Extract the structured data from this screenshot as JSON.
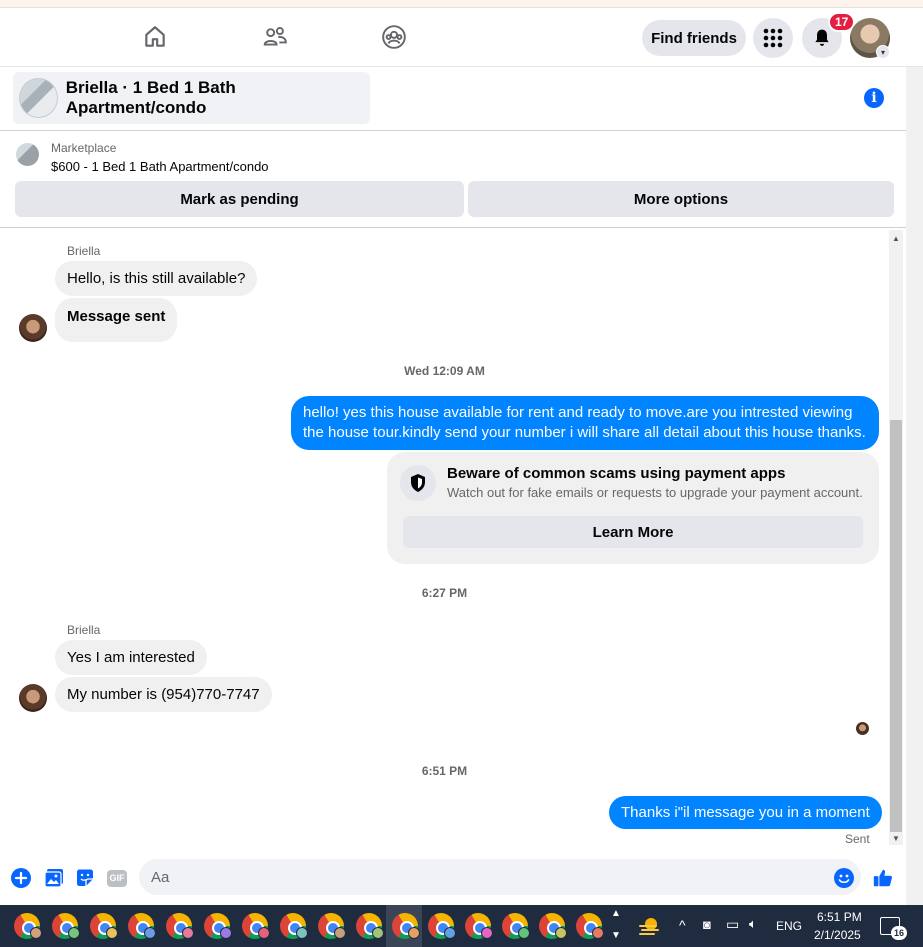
{
  "navbar": {
    "find_friends_label": "Find friends",
    "notification_count": "17"
  },
  "chat": {
    "title": "Briella · 1 Bed 1 Bath Apartment/condo"
  },
  "marketplace": {
    "label": "Marketplace",
    "listing": "$600 - 1 Bed 1 Bath Apartment/condo",
    "mark_pending_label": "Mark as pending",
    "more_options_label": "More options"
  },
  "messages": {
    "sender_name_1": "Briella",
    "incoming_1": "Hello, is this still available?",
    "incoming_2": "Message sent",
    "timestamp_1": "Wed 12:09 AM",
    "outgoing_1_line1": "hello! yes this house available for rent and ready to move.are you intrested viewing",
    "outgoing_1_line2": "the house tour.kindly send your number i will share all detail about this house thanks.",
    "scam_title": "Beware of common scams using payment apps",
    "scam_subtitle": "Watch out for fake emails or requests to upgrade your payment account.",
    "learn_more_label": "Learn More",
    "timestamp_2": "6:27 PM",
    "sender_name_2": "Briella",
    "incoming_3": "Yes I am interested",
    "incoming_4": "My number is (954)770-7747",
    "timestamp_3": "6:51 PM",
    "outgoing_2": "Thanks i\"il message you in a moment",
    "status": "Sent"
  },
  "composer": {
    "placeholder": "Aa",
    "gif_label": "GIF"
  },
  "taskbar": {
    "language": "ENG",
    "time": "6:51 PM",
    "date": "2/1/2025",
    "notification_count": "16"
  },
  "colors": {
    "accent": "#0084ff",
    "brand_blue": "#0866ff",
    "badge_red": "#e41e3f"
  }
}
